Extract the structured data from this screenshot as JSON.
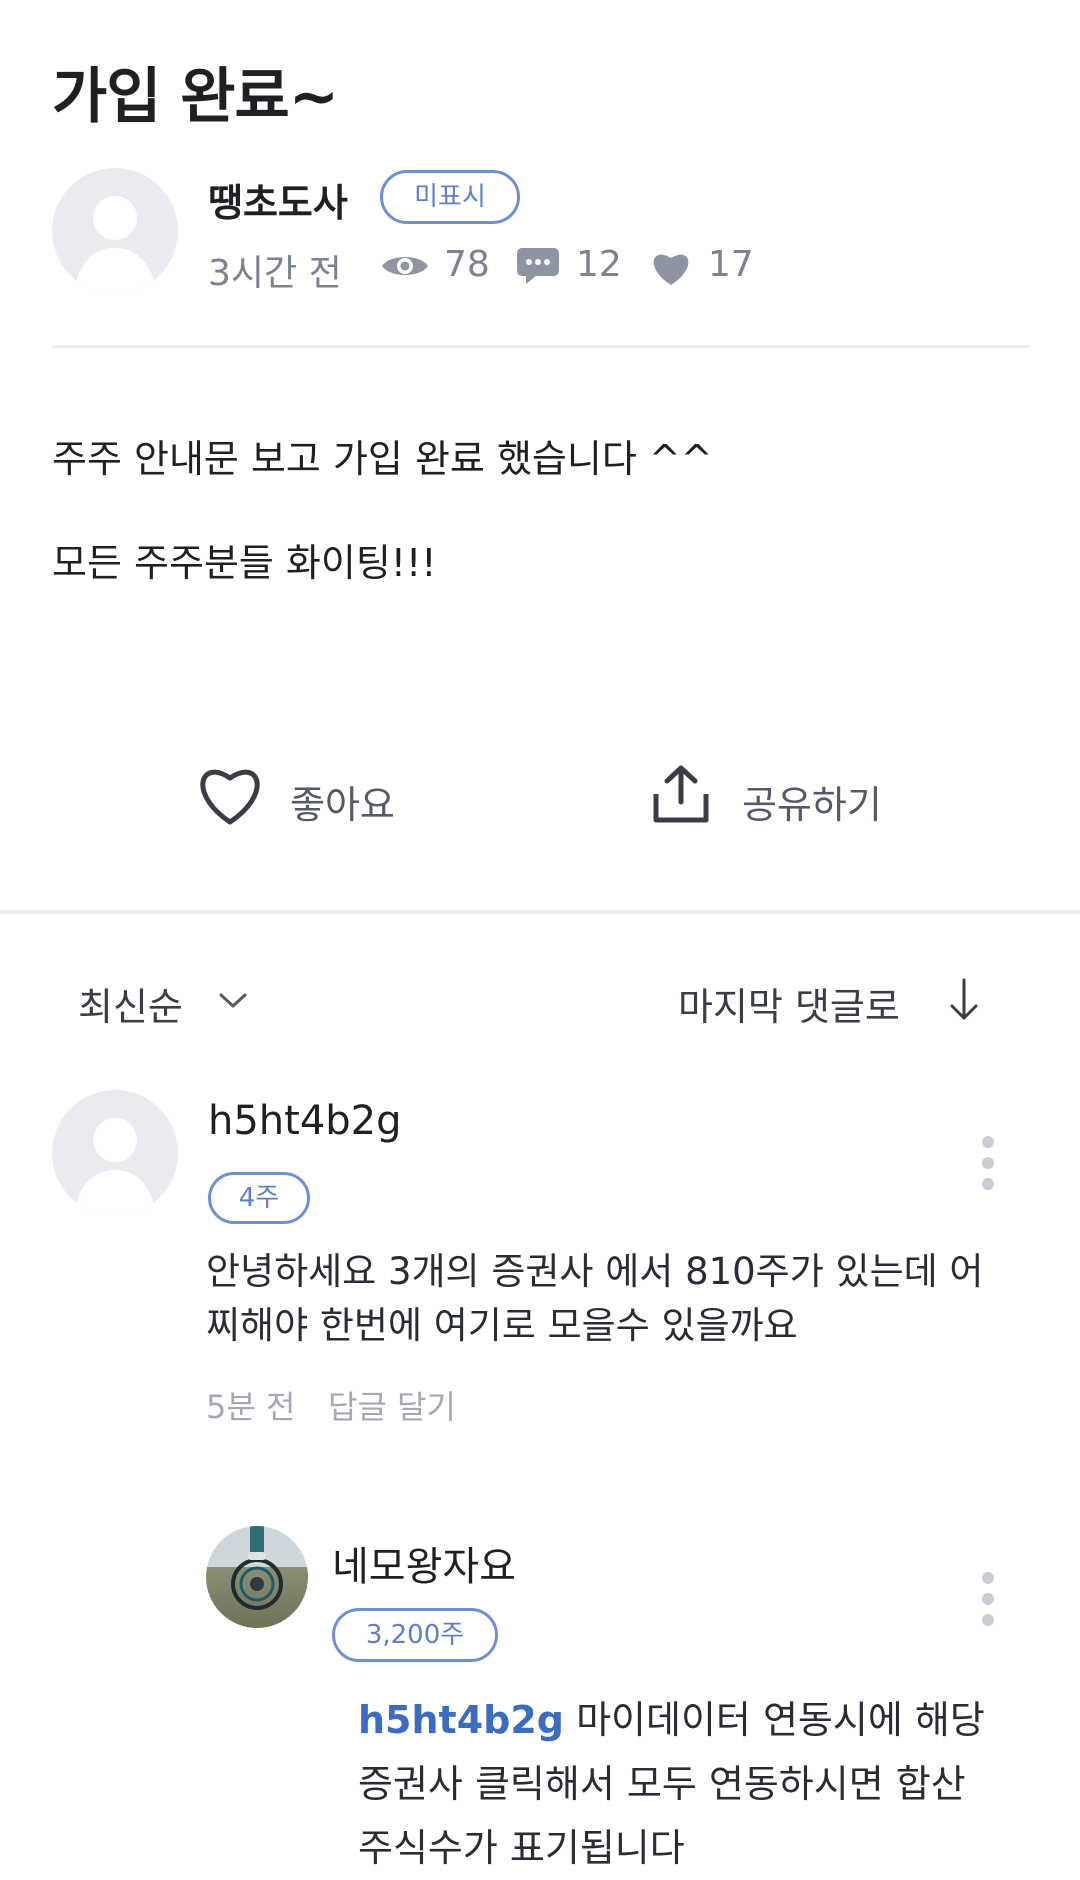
{
  "post": {
    "title": "가입 완료~",
    "author": "땡초도사",
    "badge": "미표시",
    "time": "3시간 전",
    "views": "78",
    "comments": "12",
    "likes": "17",
    "body": [
      "주주 안내문  보고  가입 완료 했습니다 ^^",
      "모든 주주분들 화이팅!!!"
    ]
  },
  "actions": {
    "like_label": "좋아요",
    "share_label": "공유하기"
  },
  "comments_bar": {
    "sort_label": "최신순",
    "jump_label": "마지막 댓글로"
  },
  "comments": [
    {
      "name": "h5ht4b2g",
      "shares": "4주",
      "lines": [
        "안녕하세요 3개의 증권사 에서 810주가 있는데 어",
        "찌해야 한번에 여기로 모을수 있을까요"
      ],
      "time": "5분 전",
      "reply_label": "답글 달기"
    }
  ],
  "reply": {
    "name": "네모왕자요",
    "shares": "3,200주",
    "mention": "h5ht4b2g",
    "line1_rest": " 마이데이터 연동시에 해당",
    "line2": "증권사 클릭해서 모두 연동하시면 합산",
    "line3": "주식수가 표기됩니다"
  },
  "colors": {
    "accent": "#5f7fcb",
    "mention": "#3c6cc2",
    "muted": "#7d8290"
  },
  "icons": [
    "eye-icon",
    "comment-icon",
    "heart-icon",
    "share-icon",
    "chevron-down-icon",
    "arrow-down-icon",
    "more-vertical-icon"
  ]
}
